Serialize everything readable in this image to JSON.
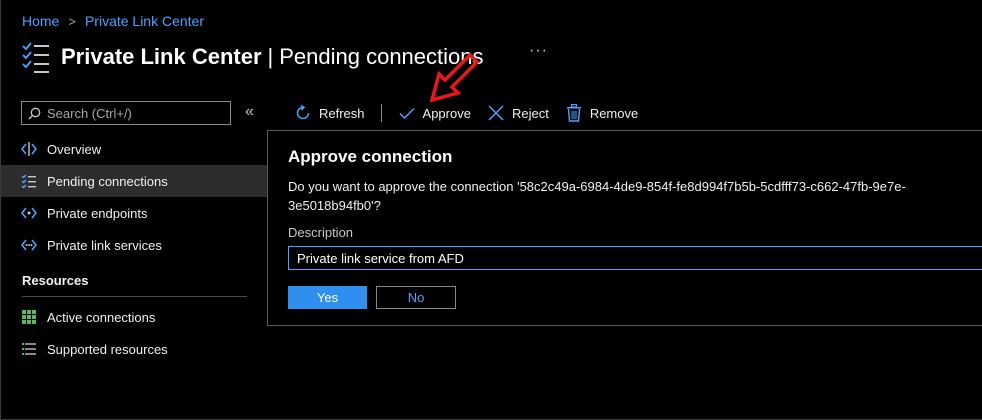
{
  "breadcrumb": {
    "home": "Home",
    "separator": ">",
    "current": "Private Link Center"
  },
  "header": {
    "title": "Private Link Center",
    "pipe": "|",
    "subtitle": "Pending connections",
    "more": "···",
    "icon": "checklist-icon"
  },
  "search": {
    "placeholder": "Search (Ctrl+/)",
    "value": "",
    "collapse": "«"
  },
  "sidebar": {
    "items": [
      {
        "label": "Overview",
        "icon": "overview-icon"
      },
      {
        "label": "Pending connections",
        "icon": "pending-icon",
        "selected": true
      },
      {
        "label": "Private endpoints",
        "icon": "endpoint-icon"
      },
      {
        "label": "Private link services",
        "icon": "link-service-icon"
      }
    ],
    "section": "Resources",
    "resource_items": [
      {
        "label": "Active connections",
        "icon": "grid-icon"
      },
      {
        "label": "Supported resources",
        "icon": "list-icon"
      }
    ]
  },
  "toolbar": {
    "refresh": "Refresh",
    "approve": "Approve",
    "reject": "Reject",
    "remove": "Remove"
  },
  "dialog": {
    "title": "Approve connection",
    "message": "Do you want to approve the connection '58c2c49a-6984-4de9-854f-fe8d994f7b5b-5cdfff73-c662-47fb-9e7e-3e5018b94fb0'?",
    "description_label": "Description",
    "description_value": "Private link service from AFD",
    "yes": "Yes",
    "no": "No"
  },
  "colors": {
    "accent": "#2f8fee",
    "link": "#4fa3ff",
    "annotation_arrow": "#e81818",
    "background": "#000000",
    "selected": "#2d2d2d"
  }
}
